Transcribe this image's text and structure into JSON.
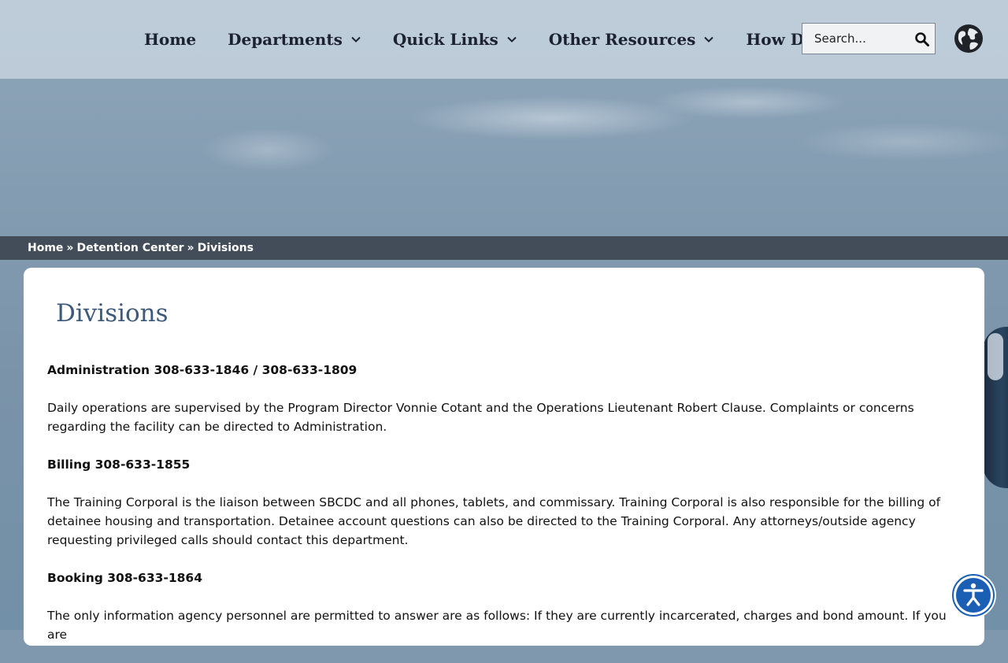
{
  "header": {
    "nav": [
      {
        "label": "Home"
      },
      {
        "label": "Departments"
      },
      {
        "label": "Quick Links"
      },
      {
        "label": "Other Resources"
      },
      {
        "label": "How Do I"
      }
    ],
    "search": {
      "placeholder": "Search..."
    }
  },
  "breadcrumb": {
    "items": [
      "Home",
      "Detention Center",
      "Divisions"
    ],
    "separator": "»"
  },
  "content": {
    "title": "Divisions",
    "sections": [
      {
        "heading": "Administration 308-633-1846 / 308-633-1809",
        "text": "Daily operations are supervised by the Program Director Vonnie Cotant and the Operations Lieutenant Robert Clause. Complaints or concerns regarding the facility can be directed to Administration."
      },
      {
        "heading": "Billing 308-633-1855",
        "text": "The Training Corporal is the liaison between SBCDC and all phones, tablets, and commissary. Training Corporal is also responsible for the billing of detainee housing and transportation. Detainee account questions can also be directed to the Training Corporal. Any attorneys/outside agency requesting privileged calls should contact this department."
      },
      {
        "heading": "Booking 308-633-1864",
        "text": "The only information agency personnel are permitted to answer are as follows: If they are currently incarcerated, charges and bond amount. If you are"
      }
    ]
  },
  "colors": {
    "title": "#3d5a7a",
    "breadcrumb_bg": "#37404a",
    "accessibility": "#1a5fb4"
  },
  "icons": {
    "chevron": "chevron-down-icon",
    "search": "search-icon",
    "language": "globe-icon",
    "accessibility": "accessibility-icon"
  }
}
